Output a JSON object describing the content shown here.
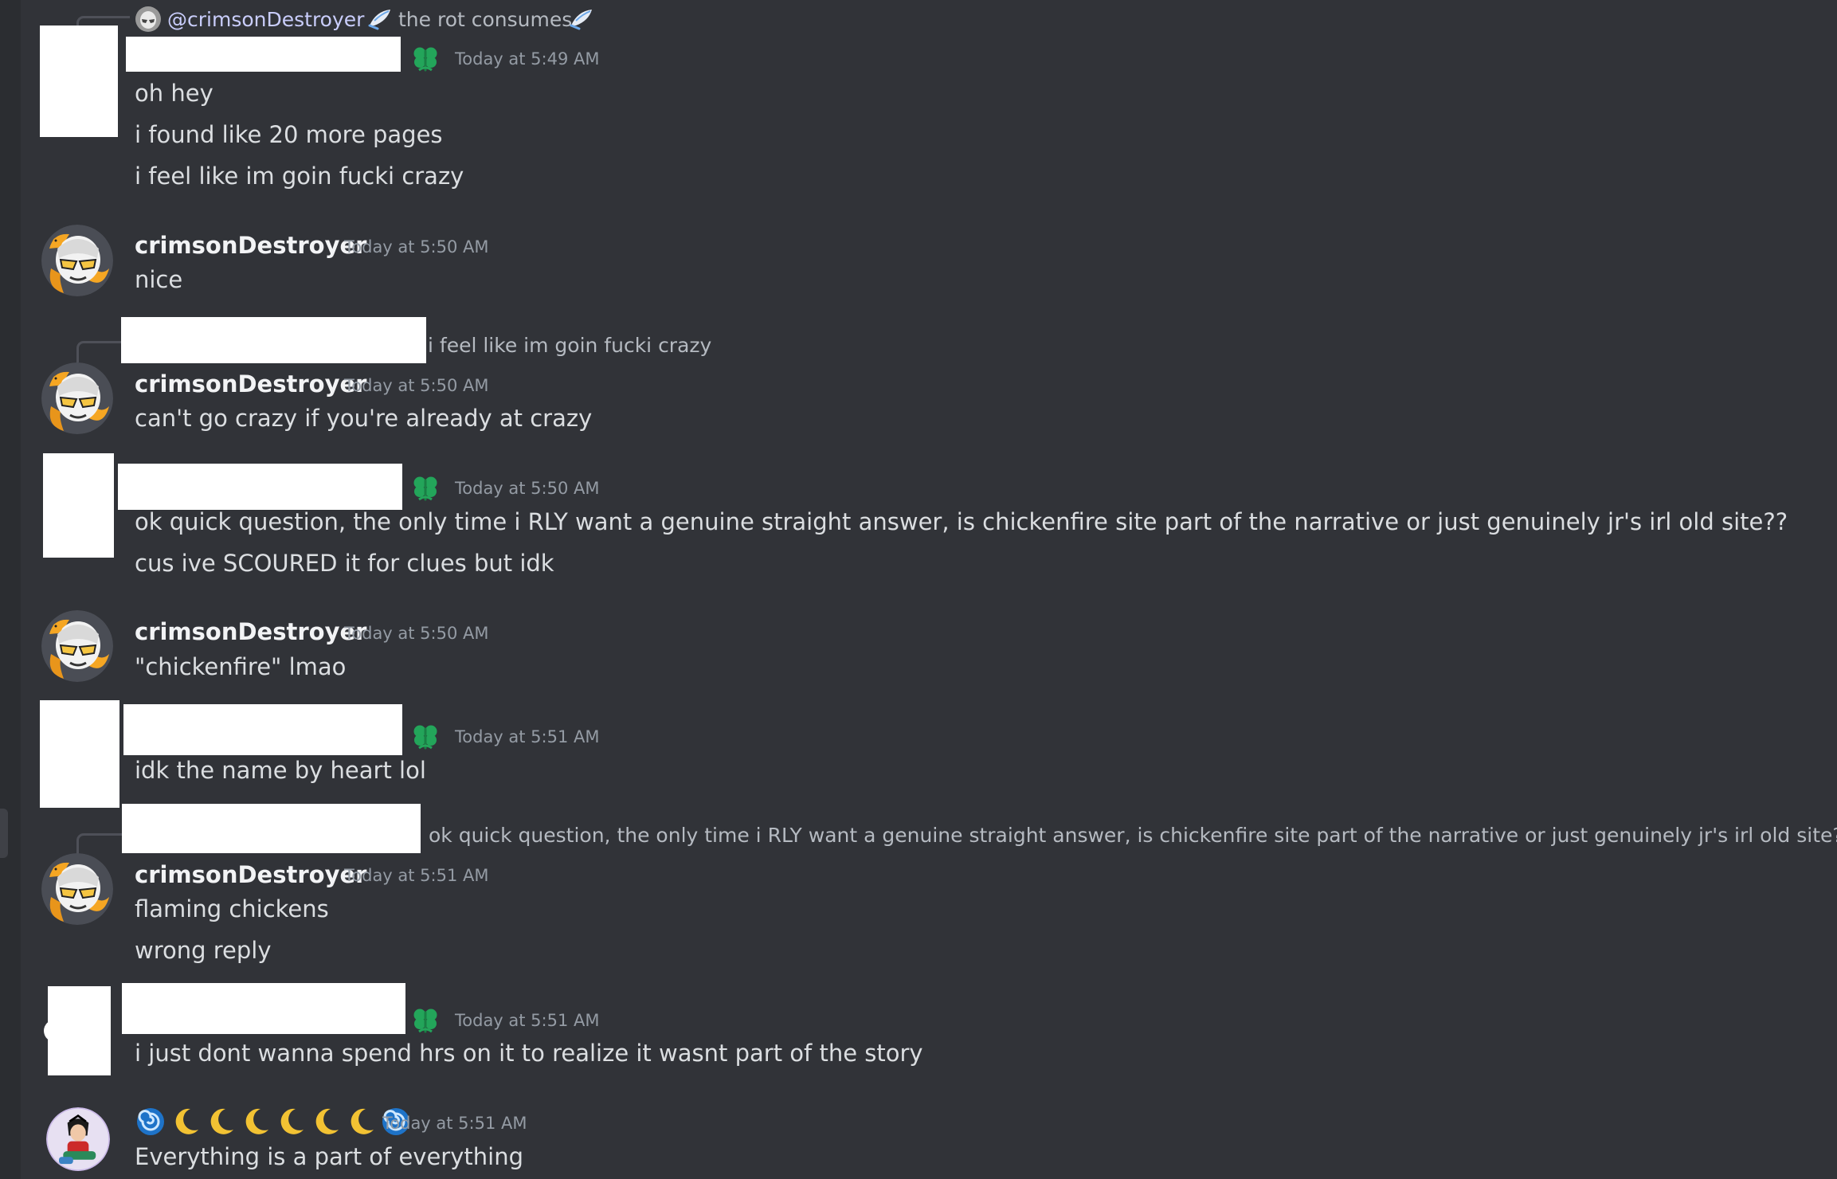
{
  "colors": {
    "background": "#313338",
    "text": "#dbdee1",
    "muted": "#949ba4",
    "badge_green": "#23a55a",
    "mention": "#c9cdfb"
  },
  "top_reply": {
    "mention": "@crimsonDestroyer",
    "preview": "the rot consumes",
    "icon_left": "feather-icon",
    "icon_right": "feather-icon"
  },
  "messages": [
    {
      "author": "",
      "timestamp": "Today at 5:49 AM",
      "badge": "clover-badge-icon",
      "lines": [
        "oh hey",
        "i found like 20 more pages",
        "i feel like im goin fucki crazy"
      ]
    },
    {
      "author": "crimsonDestroyer",
      "timestamp": "Today at 5:50 AM",
      "lines": [
        "nice"
      ]
    },
    {
      "reply_preview": "i feel like im goin fucki crazy",
      "author": "crimsonDestroyer",
      "timestamp": "Today at 5:50 AM",
      "lines": [
        "can't go crazy if you're already at crazy"
      ]
    },
    {
      "author": "",
      "timestamp": "Today at 5:50 AM",
      "badge": "clover-badge-icon",
      "lines": [
        "ok quick question, the only time i RLY want a genuine straight answer, is chickenfire site part of the narrative or just genuinely jr's irl old site??",
        "cus ive SCOURED it for clues but idk"
      ]
    },
    {
      "author": "crimsonDestroyer",
      "timestamp": "Today at 5:50 AM",
      "lines": [
        "\"chickenfire\" lmao"
      ]
    },
    {
      "author": "",
      "timestamp": "Today at 5:51 AM",
      "badge": "clover-badge-icon",
      "lines": [
        "idk the name by heart lol"
      ]
    },
    {
      "reply_preview": "ok quick question, the only time i RLY want a genuine straight answer, is chickenfire site part of the narrative or just genuinely jr's irl old site??",
      "author": "crimsonDestroyer",
      "timestamp": "Today at 5:51 AM",
      "lines": [
        "flaming chickens",
        "wrong reply"
      ]
    },
    {
      "author": "",
      "timestamp": "Today at 5:51 AM",
      "badge": "clover-badge-icon",
      "lines": [
        "i just dont wanna spend hrs on it to realize it wasnt part of the story"
      ]
    },
    {
      "author_emojis": [
        "spiral-icon",
        "crescent-moon-icon",
        "crescent-moon-icon",
        "crescent-moon-icon",
        "crescent-moon-icon",
        "crescent-moon-icon",
        "crescent-moon-icon",
        "spiral-icon"
      ],
      "timestamp": "Today at 5:51 AM",
      "lines": [
        "Everything is a part of everything"
      ]
    }
  ]
}
